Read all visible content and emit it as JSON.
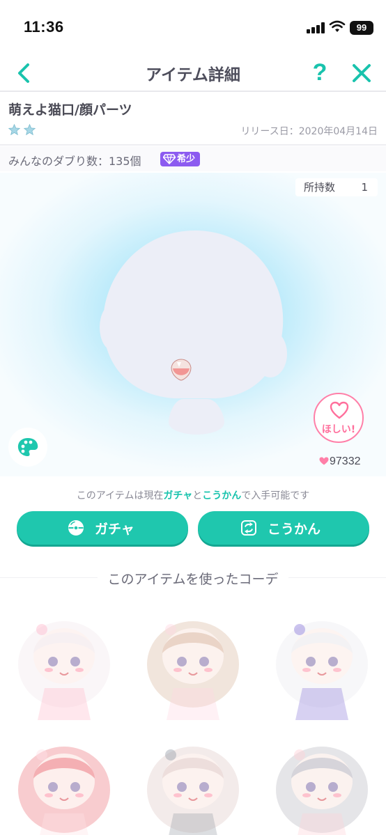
{
  "status": {
    "time": "11:36",
    "battery": "99"
  },
  "nav": {
    "title": "アイテム詳細",
    "help": "?"
  },
  "item": {
    "name": "萌えよ猫口/顔パーツ",
    "release": "リリース日：2020年04月14日",
    "duplicates": "みんなのダブり数：135個",
    "rarity_badge": "希少",
    "owned_label": "所持数",
    "owned_count": "1",
    "want_label": "ほしい!",
    "likes": "97332",
    "stars": 2
  },
  "availability": {
    "prefix": "このアイテムは現在",
    "gacha": "ガチャ",
    "and": "と",
    "trade": "こうかん",
    "suffix": "で入手可能です"
  },
  "buttons": {
    "gacha": "ガチャ",
    "trade": "こうかん"
  },
  "coordinates_section": {
    "title": "このアイテムを使ったコーデ"
  },
  "colors": {
    "accent": "#1fc7ae",
    "rare": "#8c5bf0",
    "want": "#ff7fa8"
  },
  "coordinates": [
    {
      "hair": "#f6eef2",
      "accent": "#ffb9cc",
      "icon": "twin-tail-avatar"
    },
    {
      "hair": "#e6cfbf",
      "accent": "#ffd7e2",
      "icon": "crown-avatar"
    },
    {
      "hair": "#f1f1f4",
      "accent": "#8c7bd9",
      "icon": "syringe-avatar"
    },
    {
      "hair": "#f2a3a8",
      "accent": "#ffe1e6",
      "icon": "cat-hood-avatar"
    },
    {
      "hair": "#eadad8",
      "accent": "#9aa0aa",
      "icon": "beret-avatar"
    },
    {
      "hair": "#cfcfd6",
      "accent": "#ffd0d8",
      "icon": "cat-ear-avatar"
    }
  ]
}
